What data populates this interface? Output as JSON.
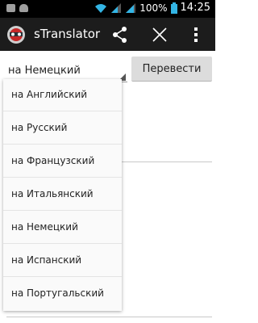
{
  "status_bar": {
    "battery_percent": "100%",
    "time": "14:25",
    "icons": [
      "image-icon",
      "android-icon",
      "wifi-icon",
      "signal-icon",
      "signal-icon",
      "battery-icon"
    ]
  },
  "action_bar": {
    "app_title": "sTranslator",
    "icons": [
      "app-logo-icon",
      "share-icon",
      "close-icon",
      "more-vert-icon"
    ]
  },
  "form": {
    "selected_language": "на Немецкий",
    "translate_button": "Перевести"
  },
  "dropdown": {
    "options": [
      "на Английский",
      "на Русский",
      "на Французский",
      "на Итальянский",
      "на Немецкий",
      "на Испанский",
      "на Португальский"
    ]
  },
  "colors": {
    "status_bar_bg": "#000000",
    "action_bar_bg": "#1c1c1c",
    "accent": "#33b5e5",
    "button_bg": "#dcdcdc"
  }
}
